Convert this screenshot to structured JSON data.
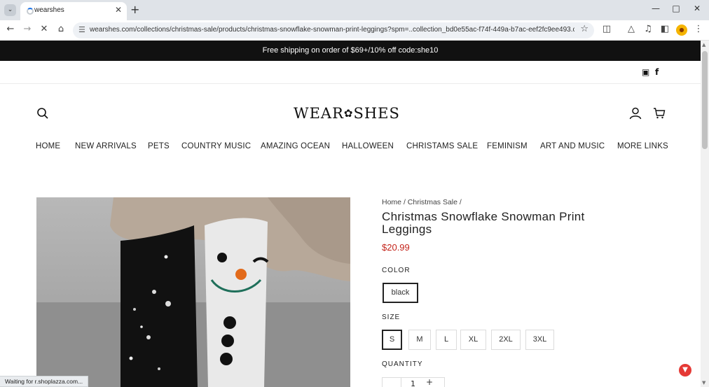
{
  "browser": {
    "tab_title": "wearshes",
    "url": "wearshes.com/collections/christmas-sale/products/christmas-snowflake-snowman-print-leggings?spm=..collection_bd0e55ac-f74f-449a-b7ac-eef2fc9ee493.collection_1.5",
    "status_text": "Waiting for r.shoplazza.com..."
  },
  "store": {
    "announcement": "Free shipping on order of $69+/10% off code:she10",
    "logo_left": "WEAR",
    "logo_right": "SHES"
  },
  "nav": {
    "items": [
      "HOME",
      "NEW ARRIVALS",
      "PETS",
      "COUNTRY MUSIC",
      "AMAZING OCEAN",
      "HALLOWEEN",
      "CHRISTAMS SALE",
      "FEMINISM",
      "ART AND MUSIC",
      "MORE LINKS"
    ]
  },
  "product": {
    "breadcrumb": [
      "Home",
      "Christmas Sale"
    ],
    "breadcrumb_sep": "/",
    "title": "Christmas Snowflake Snowman Print Leggings",
    "price": "$20.99",
    "color_label": "COLOR",
    "colors": [
      "black"
    ],
    "size_label": "SIZE",
    "sizes": [
      "S",
      "M",
      "L",
      "XL",
      "2XL",
      "3XL"
    ],
    "selected_size": "S",
    "quantity_label": "QUANTITY",
    "quantity": "1"
  },
  "colors": {
    "announce_bg": "#111111",
    "price": "#c4241b"
  }
}
